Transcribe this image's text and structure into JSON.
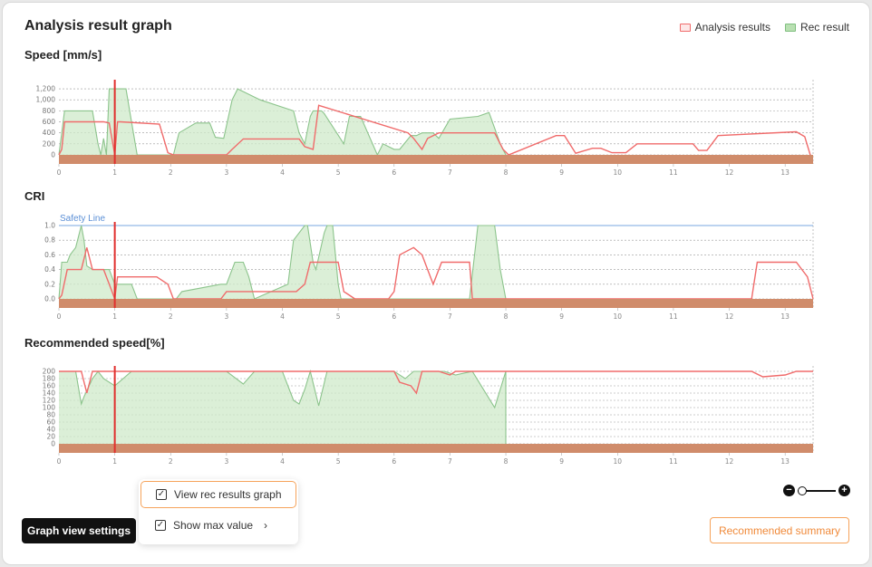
{
  "header": {
    "title": "Analysis result graph"
  },
  "legend": [
    {
      "label": "Analysis results",
      "color": "#f06b6b",
      "fill": "#fde8e8"
    },
    {
      "label": "Rec result",
      "color": "#7fbf7f",
      "fill": "#b9e0b2"
    }
  ],
  "colors": {
    "analysis_line": "#f06b6b",
    "rec_line": "#8cc48c",
    "rec_fill": "#cfe9c9",
    "ground": "#d08c6b",
    "safety": "#7aa7e0"
  },
  "x_ticks": [
    "0",
    "1",
    "2",
    "3",
    "4",
    "5",
    "6",
    "7",
    "8",
    "9",
    "10",
    "11",
    "12",
    "13"
  ],
  "chart_data": [
    {
      "type": "area",
      "title": "Speed [mm/s]",
      "ylim": [
        0,
        1300
      ],
      "y_ticks": [
        "0",
        "200",
        "400",
        "600",
        "800",
        "1,000",
        "1,200"
      ],
      "y_values": [
        0,
        200,
        400,
        600,
        800,
        1000,
        1200
      ],
      "xlim": [
        0,
        13.5
      ],
      "marker_x": 1.0,
      "series": [
        {
          "name": "Analysis results",
          "x": [
            0,
            0.05,
            0.1,
            0.8,
            0.9,
            1.0,
            1.05,
            1.1,
            1.8,
            1.95,
            2.05,
            3.0,
            3.1,
            3.3,
            4.3,
            4.4,
            4.55,
            4.65,
            6.25,
            6.35,
            6.5,
            6.6,
            6.8,
            7.8,
            7.95,
            8.05,
            8.9,
            9.05,
            9.25,
            9.55,
            9.7,
            9.9,
            10.15,
            10.35,
            11.35,
            11.45,
            11.6,
            11.8,
            13.2,
            13.35,
            13.45
          ],
          "y": [
            0,
            100,
            600,
            600,
            580,
            0,
            600,
            600,
            560,
            40,
            0,
            0,
            100,
            290,
            290,
            150,
            100,
            900,
            400,
            300,
            100,
            300,
            400,
            400,
            100,
            0,
            350,
            350,
            30,
            120,
            120,
            40,
            40,
            200,
            200,
            80,
            80,
            350,
            420,
            330,
            0
          ]
        },
        {
          "name": "Rec result",
          "x": [
            0,
            0.05,
            0.1,
            0.6,
            0.7,
            0.75,
            0.8,
            0.85,
            0.9,
            1.0,
            1.05,
            1.1,
            1.15,
            1.2,
            1.3,
            1.4,
            1.5,
            1.7,
            1.8,
            1.9,
            2.05,
            2.15,
            2.45,
            2.7,
            2.8,
            2.95,
            3.1,
            3.2,
            3.6,
            4.2,
            4.3,
            4.4,
            4.5,
            4.55,
            4.65,
            4.7,
            4.75,
            5.1,
            5.2,
            5.4,
            5.7,
            5.8,
            6.0,
            6.1,
            6.3,
            6.4,
            6.5,
            6.7,
            6.8,
            7.0,
            7.5,
            7.7,
            7.9,
            8.0
          ],
          "y": [
            0,
            400,
            800,
            800,
            200,
            0,
            300,
            0,
            1200,
            1200,
            1200,
            1200,
            1200,
            1200,
            600,
            0,
            0,
            0,
            0,
            0,
            0,
            400,
            580,
            580,
            320,
            300,
            1000,
            1200,
            1000,
            800,
            400,
            200,
            700,
            800,
            800,
            800,
            750,
            200,
            700,
            700,
            0,
            200,
            100,
            100,
            350,
            350,
            400,
            400,
            300,
            650,
            700,
            770,
            200,
            0
          ]
        }
      ]
    },
    {
      "type": "area",
      "title": "CRI",
      "ylim": [
        0,
        1.0
      ],
      "y_ticks": [
        "0.0",
        "0.2",
        "0.4",
        "0.6",
        "0.8",
        "1.0"
      ],
      "y_values": [
        0,
        0.2,
        0.4,
        0.6,
        0.8,
        1.0
      ],
      "xlim": [
        0,
        13.5
      ],
      "marker_x": 1.0,
      "safety_line": {
        "label": "Safety Line",
        "y": 1.0
      },
      "series": [
        {
          "name": "Analysis results",
          "x": [
            0,
            0.05,
            0.15,
            0.4,
            0.5,
            0.6,
            0.8,
            0.9,
            1.0,
            1.05,
            1.1,
            1.2,
            1.75,
            1.95,
            2.05,
            2.2,
            2.9,
            3.0,
            3.1,
            4.25,
            4.4,
            4.5,
            4.6,
            5.0,
            5.1,
            5.3,
            5.8,
            5.9,
            6.0,
            6.1,
            6.35,
            6.5,
            6.7,
            6.85,
            7.0,
            7.1,
            7.35,
            7.4,
            12.4,
            12.5,
            13.2,
            13.4,
            13.5
          ],
          "y": [
            0,
            0.05,
            0.4,
            0.4,
            0.7,
            0.4,
            0.4,
            0.2,
            0.0,
            0.3,
            0.3,
            0.3,
            0.3,
            0.2,
            0.0,
            0.0,
            0.0,
            0.1,
            0.1,
            0.1,
            0.2,
            0.5,
            0.5,
            0.5,
            0.1,
            0.0,
            0.0,
            0.0,
            0.1,
            0.6,
            0.7,
            0.6,
            0.2,
            0.5,
            0.5,
            0.5,
            0.5,
            0.0,
            0.0,
            0.5,
            0.5,
            0.3,
            0.0
          ]
        },
        {
          "name": "Rec result",
          "x": [
            0,
            0.05,
            0.15,
            0.2,
            0.3,
            0.4,
            0.45,
            0.5,
            0.6,
            0.9,
            1.0,
            1.2,
            1.3,
            1.4,
            1.9,
            2.1,
            2.2,
            2.9,
            3.0,
            3.15,
            3.3,
            3.4,
            3.5,
            4.1,
            4.2,
            4.4,
            4.45,
            4.55,
            4.6,
            4.75,
            4.8,
            4.9,
            5.0,
            5.05,
            7.35,
            7.5,
            7.8,
            7.9,
            8.0
          ],
          "y": [
            0,
            0.5,
            0.5,
            0.6,
            0.7,
            1.0,
            0.8,
            0.45,
            0.4,
            0.4,
            0.2,
            0.2,
            0.2,
            0.0,
            0.0,
            0.0,
            0.1,
            0.2,
            0.2,
            0.5,
            0.5,
            0.3,
            0.0,
            0.2,
            0.8,
            1.0,
            1.0,
            0.5,
            0.4,
            0.9,
            1.0,
            1.0,
            0.2,
            0.0,
            0.0,
            1.0,
            1.0,
            0.4,
            0.0
          ]
        }
      ]
    },
    {
      "type": "area",
      "title": "Recommended speed[%]",
      "ylim": [
        0,
        205
      ],
      "y_ticks": [
        "0",
        "20",
        "40",
        "60",
        "80",
        "100",
        "120",
        "140",
        "160",
        "180",
        "200"
      ],
      "y_values": [
        0,
        20,
        40,
        60,
        80,
        100,
        120,
        140,
        160,
        180,
        200
      ],
      "xlim": [
        0,
        13.5
      ],
      "marker_x": 1.0,
      "series": [
        {
          "name": "Analysis results",
          "x": [
            0,
            0.4,
            0.5,
            0.6,
            0.7,
            1.0,
            1.05,
            1.1,
            6.0,
            6.1,
            6.3,
            6.4,
            6.5,
            6.6,
            6.8,
            7.0,
            7.1,
            7.3,
            7.4,
            12.4,
            12.6,
            13.0,
            13.2,
            13.5
          ],
          "y": [
            200,
            200,
            140,
            200,
            200,
            200,
            200,
            200,
            200,
            170,
            160,
            140,
            200,
            200,
            200,
            190,
            200,
            200,
            200,
            200,
            185,
            190,
            200,
            200
          ]
        },
        {
          "name": "Rec result",
          "x": [
            0,
            0.3,
            0.4,
            0.45,
            0.6,
            0.7,
            0.8,
            1.0,
            1.3,
            1.4,
            2.5,
            3.0,
            3.3,
            3.5,
            4.0,
            4.2,
            4.3,
            4.4,
            4.5,
            4.65,
            4.8,
            4.9,
            5.0,
            5.8,
            6.0,
            6.2,
            6.35,
            6.5,
            6.6,
            6.9,
            7.1,
            7.4,
            7.8,
            8.0,
            8.0
          ],
          "y": [
            200,
            200,
            110,
            130,
            180,
            200,
            180,
            160,
            200,
            200,
            200,
            200,
            165,
            200,
            200,
            120,
            110,
            150,
            200,
            105,
            200,
            200,
            200,
            200,
            200,
            180,
            200,
            200,
            200,
            200,
            190,
            200,
            100,
            200,
            0
          ]
        }
      ]
    }
  ],
  "popup": {
    "options": [
      {
        "label": "View rec results graph",
        "checked": true
      },
      {
        "label": "Show max value",
        "checked": true
      }
    ]
  },
  "buttons": {
    "graph_settings": "Graph view settings",
    "recommended_summary": "Recommended summary"
  },
  "zoom": {
    "minus": "−",
    "plus": "+",
    "level": 0
  }
}
